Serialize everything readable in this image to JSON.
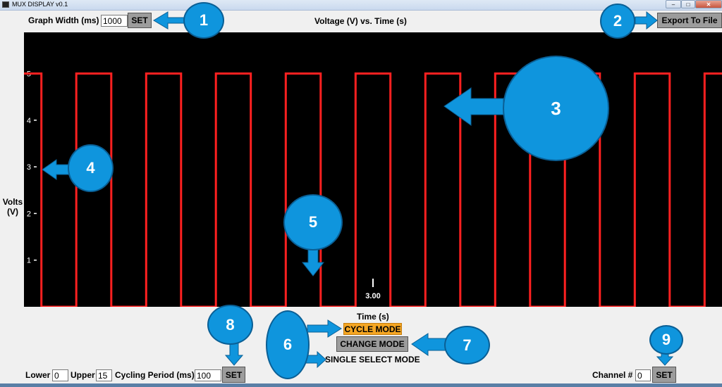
{
  "window": {
    "title": "MUX DISPLAY v0.1"
  },
  "header": {
    "graph_width_label": "Graph Width (ms)",
    "graph_width_value": "1000",
    "set_label": "SET",
    "chart_title": "Voltage (V) vs. Time (s)",
    "export_label": "Export To File"
  },
  "chart_data": {
    "type": "line",
    "title": "Voltage (V) vs. Time (s)",
    "xlabel": "Time (s)",
    "ylabel": "Volts (V)",
    "ylim": [
      0,
      5.5
    ],
    "y_ticks": [
      "1",
      "2",
      "3",
      "4",
      "5"
    ],
    "x_tick_labels": [
      "3.00"
    ],
    "grid": false,
    "series": [
      {
        "color": "#ff2020",
        "x": [
          2.0,
          2.05,
          2.05,
          2.15,
          2.15,
          2.25,
          2.25,
          2.35,
          2.35,
          2.45,
          2.45,
          2.55,
          2.55,
          2.65,
          2.65,
          2.75,
          2.75,
          2.85,
          2.85,
          2.95,
          2.95,
          3.05,
          3.05,
          3.15,
          3.15,
          3.25,
          3.25,
          3.35,
          3.35,
          3.45,
          3.45,
          3.55,
          3.55,
          3.65,
          3.65,
          3.75,
          3.75,
          3.85,
          3.85,
          3.95,
          3.95,
          4.0
        ],
        "y": [
          5,
          5,
          0,
          0,
          5,
          5,
          0,
          0,
          5,
          5,
          0,
          0,
          5,
          5,
          0,
          0,
          5,
          5,
          0,
          0,
          5,
          5,
          0,
          0,
          5,
          5,
          0,
          0,
          5,
          5,
          0,
          0,
          5,
          5,
          0,
          0,
          5,
          5,
          0,
          0,
          5,
          5
        ]
      }
    ]
  },
  "mode": {
    "cycle_mode_label": "CYCLE MODE",
    "change_mode_label": "CHANGE MODE",
    "single_select_label": "SINGLE SELECT MODE",
    "cycle_color": "#f5a623"
  },
  "footer": {
    "lower_label": "Lower",
    "lower_value": "0",
    "upper_label": "Upper",
    "upper_value": "15",
    "cycling_label": "Cycling Period (ms)",
    "cycling_value": "100",
    "set_label": "SET",
    "channel_label": "Channel #",
    "channel_value": "0",
    "channel_set_label": "SET"
  },
  "callouts": [
    "1",
    "2",
    "3",
    "4",
    "5",
    "6",
    "7",
    "8",
    "9"
  ],
  "colors": {
    "callout": "#0f95dd",
    "signal": "#ff2020"
  }
}
